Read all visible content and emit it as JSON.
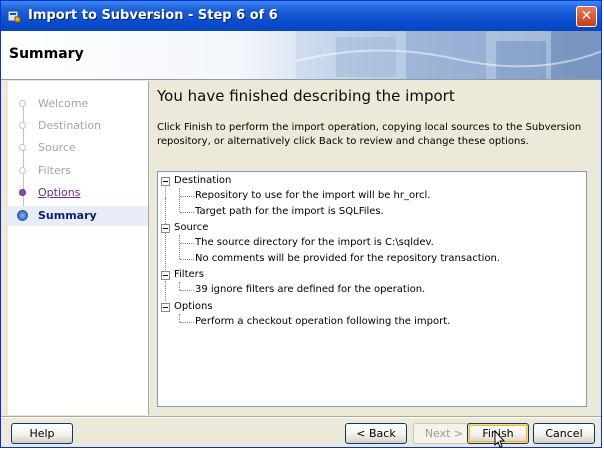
{
  "window": {
    "title": "Import to Subversion - Step 6 of 6",
    "close_glyph": "✕"
  },
  "header": {
    "title": "Summary"
  },
  "nav": {
    "items": [
      {
        "label": "Welcome",
        "state": "past"
      },
      {
        "label": "Destination",
        "state": "past"
      },
      {
        "label": "Source",
        "state": "past"
      },
      {
        "label": "Filters",
        "state": "past"
      },
      {
        "label": "Options",
        "state": "visited"
      },
      {
        "label": "Summary",
        "state": "current"
      }
    ]
  },
  "main": {
    "heading": "You have finished describing the import",
    "description": "Click Finish to perform the import operation, copying local sources to the Subversion repository, or alternatively click Back to review and change these options."
  },
  "tree": {
    "groups": [
      {
        "label": "Destination",
        "children": [
          "Repository to use for the import will be hr_orcl.",
          "Target path for the import is SQLFiles."
        ]
      },
      {
        "label": "Source",
        "children": [
          "The source directory for the import is C:\\sqldev.",
          "No comments will be provided for the repository transaction."
        ]
      },
      {
        "label": "Filters",
        "children": [
          "39 ignore filters are defined for the operation."
        ]
      },
      {
        "label": "Options",
        "children": [
          "Perform a checkout operation following the import."
        ]
      }
    ]
  },
  "footer": {
    "help": "Help",
    "back": "< Back",
    "next": "Next >",
    "finish": "Finish",
    "cancel": "Cancel"
  },
  "colors": {
    "titlebar": "#0a4dcc",
    "accent": "#3d6bc4",
    "visited_link": "#6a2d8e"
  }
}
